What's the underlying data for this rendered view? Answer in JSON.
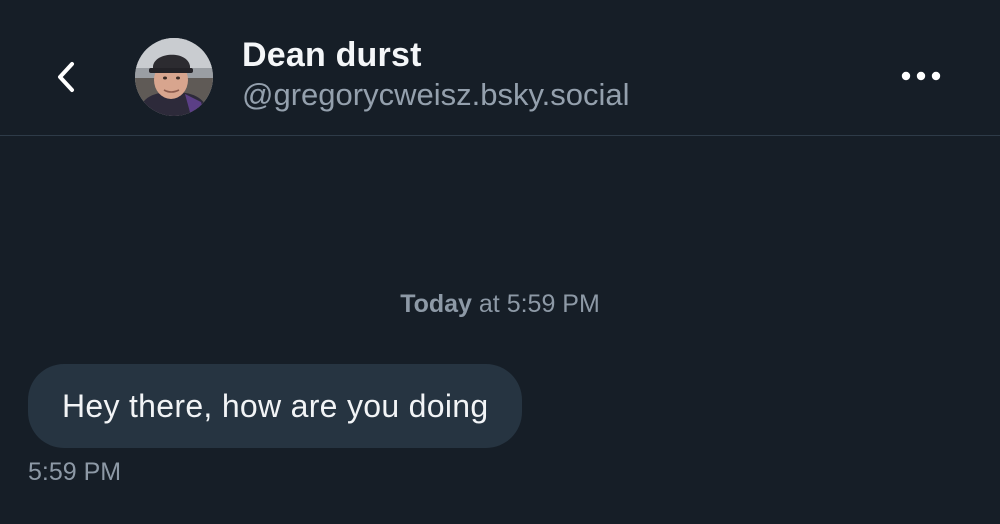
{
  "header": {
    "back_icon": "chevron-left-icon",
    "avatar_icon": "user-avatar",
    "display_name": "Dean durst",
    "handle": "@gregorycweisz.bsky.social",
    "more_icon": "ellipsis-icon"
  },
  "conversation": {
    "date_separator": {
      "day": "Today",
      "time": "at 5:59 PM"
    },
    "messages": [
      {
        "text": "Hey there, how are you doing",
        "time": "5:59 PM"
      }
    ]
  },
  "colors": {
    "background": "#161e27",
    "bubble": "#263441",
    "muted_text": "#8d99a6",
    "divider": "#2e3b48"
  }
}
